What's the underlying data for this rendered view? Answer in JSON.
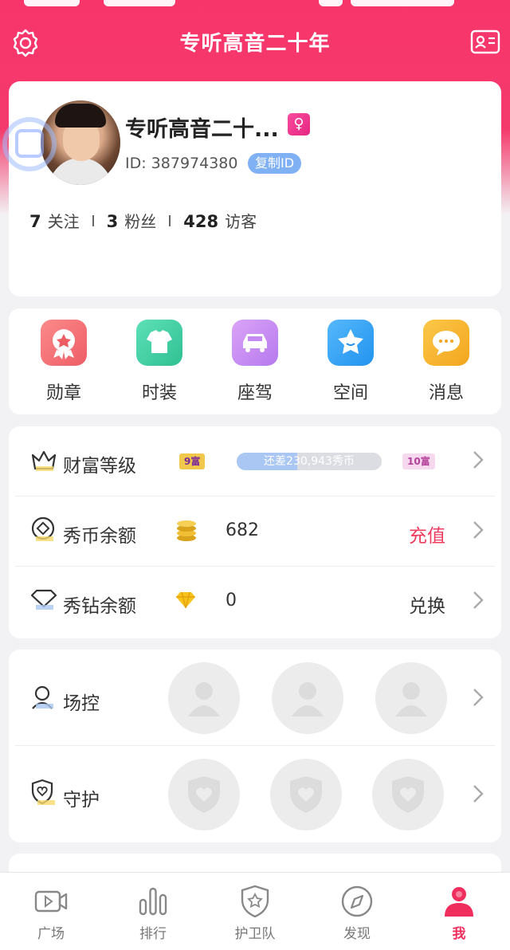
{
  "header": {
    "title": "专听高音二十年",
    "settings_icon": "gear-icon",
    "card_icon": "id-card-icon"
  },
  "profile": {
    "nickname": "专听高音二十...",
    "gender_symbol": "♀",
    "id_text": "ID: 387974380",
    "copy_id_label": "复制ID",
    "following_count": "7",
    "following_label": "关注",
    "fans_count": "3",
    "fans_label": "粉丝",
    "visitors_count": "428",
    "visitors_label": "访客"
  },
  "quick_links": [
    {
      "label": "勋章",
      "icon": "medal-icon",
      "color": "#f26a72"
    },
    {
      "label": "时装",
      "icon": "shirt-icon",
      "color": "#3fcfa2"
    },
    {
      "label": "座驾",
      "icon": "car-icon",
      "color": "#c98bf0"
    },
    {
      "label": "空间",
      "icon": "star-icon",
      "color": "#36a6f5"
    },
    {
      "label": "消息",
      "icon": "chat-icon",
      "color": "#f7b32a"
    }
  ],
  "wealth": {
    "label": "财富等级",
    "current_level": "9富",
    "next_level": "10富",
    "progress_text": "还差230,943秀币",
    "progress_fraction": 0.42
  },
  "coins": {
    "label": "秀币余额",
    "value": "682",
    "action": "充值",
    "action_color": "#ef3c5e"
  },
  "diamonds": {
    "label": "秀钻余额",
    "value": "0",
    "action": "兑换"
  },
  "control": {
    "label": "场控"
  },
  "guard": {
    "label": "守护"
  },
  "tabs": [
    {
      "label": "广场",
      "icon": "video-icon",
      "active": false
    },
    {
      "label": "排行",
      "icon": "bar-chart-icon",
      "active": false
    },
    {
      "label": "护卫队",
      "icon": "shield-star-icon",
      "active": false
    },
    {
      "label": "发现",
      "icon": "compass-icon",
      "active": false
    },
    {
      "label": "我",
      "icon": "user-icon",
      "active": true
    }
  ],
  "colors": {
    "brand": "#f43a6c",
    "active_tab": "#ef2e5e"
  }
}
